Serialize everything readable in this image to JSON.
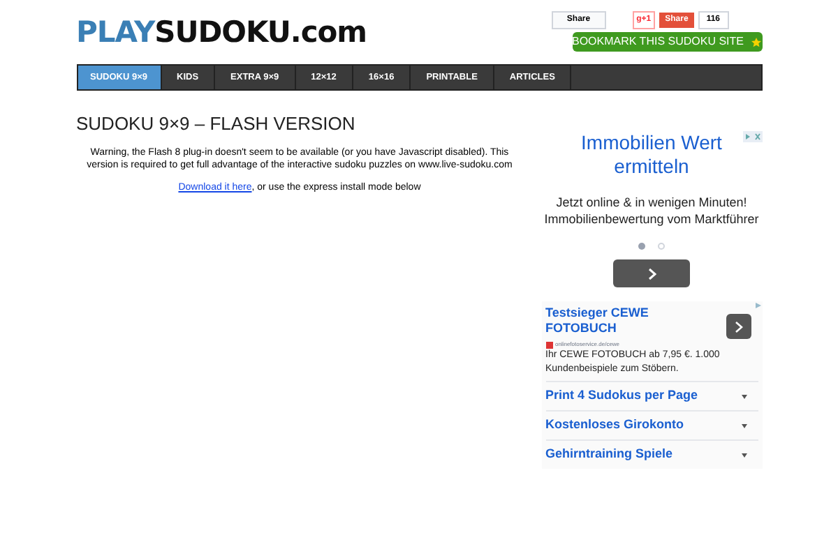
{
  "logo": {
    "first": "PLAY",
    "second": "SUDOKU",
    "suffix": ".com"
  },
  "social": {
    "share": "Share",
    "gplus": "g+1",
    "gshare": "Share",
    "count": "116"
  },
  "bookmark": "BOOKMARK THIS SUDOKU SITE",
  "nav": [
    {
      "label": "SUDOKU 9×9",
      "selected": true
    },
    {
      "label": "KIDS",
      "selected": false
    },
    {
      "label": "EXTRA 9×9",
      "selected": false
    },
    {
      "label": "12×12",
      "selected": false
    },
    {
      "label": "16×16",
      "selected": false
    },
    {
      "label": "PRINTABLE",
      "selected": false
    },
    {
      "label": "ARTICLES",
      "selected": false
    }
  ],
  "heading": "SUDOKU 9×9 – FLASH VERSION",
  "warning": "Warning, the Flash 8 plug-in doesn't seem to be available (or you have Javascript disabled). This version is required to get full advantage of the interactive sudoku puzzles on www.live-sudoku.com",
  "download_link": "Download it here",
  "download_rest": ", or use the express install mode below",
  "ad1": {
    "title": "Immobilien Wert ermitteln",
    "body": "Jetzt online & in wenigen Minuten! Immobilienbewertung vom Marktführer",
    "dots": [
      {
        "selected": true
      },
      {
        "selected": false
      }
    ]
  },
  "ad2": {
    "title": "Testsieger CEWE FOTOBUCH",
    "source": "onlinefotoservice.de/cewe",
    "body": "Ihr CEWE FOTOBUCH ab 7,95 €. 1.000 Kundenbeispiele zum Stöbern.",
    "links": [
      "Print 4 Sudokus per Page",
      "Kostenloses Girokonto",
      "Gehirntraining Spiele"
    ]
  }
}
